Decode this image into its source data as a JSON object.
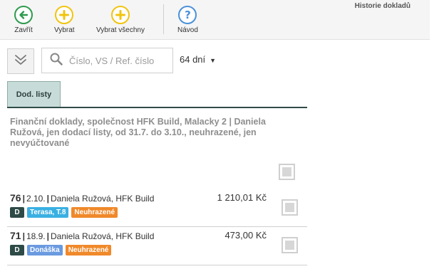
{
  "toolbar": {
    "close_label": "Zavřít",
    "select_label": "Vybrat",
    "select_all_label": "Vybrat všechny",
    "help_label": "Návod",
    "history_title": "Historie dokladů"
  },
  "search": {
    "placeholder": "Číslo, VS / Ref. číslo",
    "value": "",
    "days_value": "64 dní"
  },
  "tabs": [
    {
      "label": "Dod. listy",
      "active": true
    }
  ],
  "description": "Finanční doklady, společnost HFK Build, Malacky 2 | Daniela Ružová, jen dodací listy, od 31.7. do 3.10., neuhrazené, jen nevyúčtované",
  "rows": [
    {
      "number": "76",
      "date": "2.10.",
      "party": "Daniela Ružová, HFK Build",
      "amount": "1 210,01 Kč",
      "type_badge": "D",
      "tag": "Terasa, T.8",
      "tag_color": "#3ab0e2",
      "status": "Neuhrazené",
      "status_color": "#f0892a"
    },
    {
      "number": "71",
      "date": "18.9.",
      "party": "Daniela Ružová, HFK Build",
      "amount": "473,00 Kč",
      "type_badge": "D",
      "tag": "Donáška",
      "tag_color": "#6a9ae0",
      "status": "Neuhrazené",
      "status_color": "#f0892a"
    }
  ],
  "colors": {
    "close_green": "#2e9a4e",
    "select_yellow": "#f1c40f",
    "help_blue": "#4a90d9",
    "tab_bg": "#c7dcd8",
    "tab_line": "#2f4c48",
    "badge_d": "#2d4a47"
  },
  "icons": [
    "arrow-left-icon",
    "plus-icon",
    "plus-icon",
    "question-icon",
    "double-chevron-down-icon",
    "search-icon",
    "caret-down-icon"
  ]
}
